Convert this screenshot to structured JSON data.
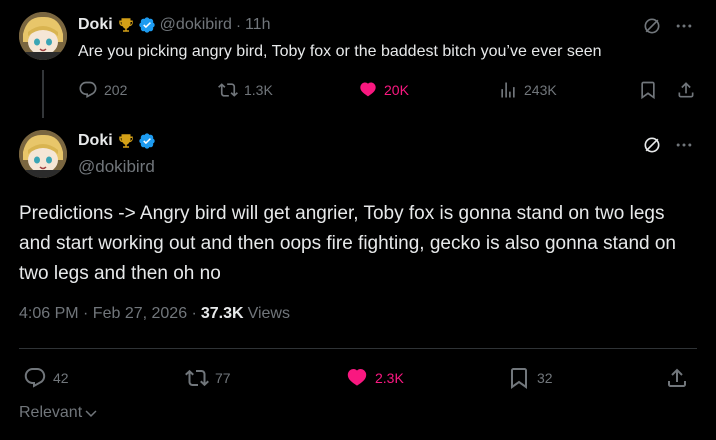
{
  "reply": {
    "author_name": "Doki",
    "author_handle": "@dokibird",
    "separator": "·",
    "time": "11h",
    "text": "Are you picking angry bird, Toby fox or the baddest bitch you’ve ever seen",
    "stats": {
      "replies": "202",
      "reposts": "1.3K",
      "likes": "20K",
      "views": "243K"
    }
  },
  "main": {
    "author_name": "Doki",
    "author_handle": "@dokibird",
    "text": "Predictions -> Angry bird will get angrier, Toby fox is gonna stand on two legs and start working out and then oops fire fighting, gecko is also gonna stand on two legs and then oh no",
    "timestamp": "4:06 PM · Feb 27, 2026 ·",
    "views_count": "37.3K",
    "views_label": "Views",
    "stats": {
      "replies": "42",
      "reposts": "77",
      "likes": "2.3K",
      "bookmarks": "32"
    }
  },
  "footer": {
    "sort_label": "Relevant"
  },
  "colors": {
    "background": "#000000",
    "text": "#e7e9ea",
    "muted": "#71767b",
    "like": "#f91880",
    "verified": "#1d9bf0",
    "trophy": "#d4a017"
  }
}
